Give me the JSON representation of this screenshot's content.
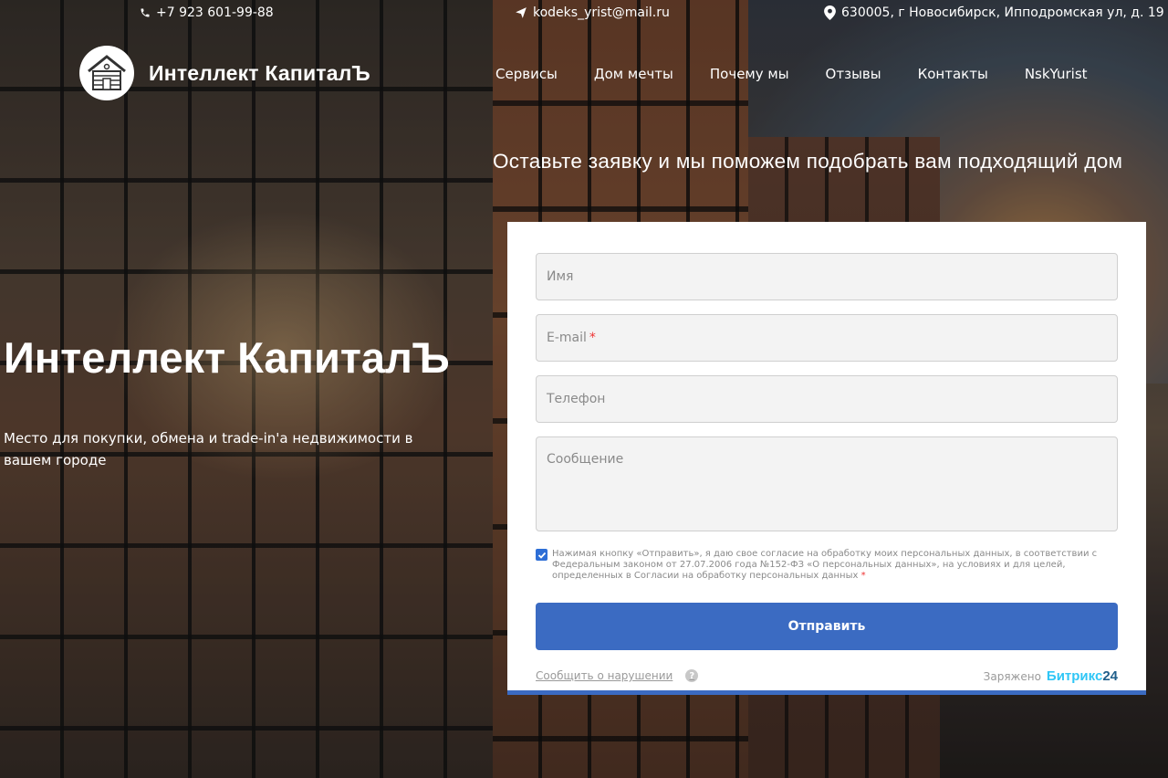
{
  "topbar": {
    "phone": "+7 923 601-99-88",
    "email": "kodeks_yrist@mail.ru",
    "address": "630005, г Новосибирск, Ипподромская ул, д. 19"
  },
  "brand": {
    "name": "Интеллект КапиталЪ"
  },
  "nav": {
    "items": [
      "Сервисы",
      "Дом мечты",
      "Почему мы",
      "Отзывы",
      "Контакты",
      "NskYurist"
    ]
  },
  "hero": {
    "title": "Интеллект КапиталЪ",
    "subtitle": "Место для покупки, обмена и trade-in'a недвижимости в вашем городе"
  },
  "cta": "Оставьте заявку и мы поможем подобрать вам подходящий дом",
  "form": {
    "name_placeholder": "Имя",
    "email_placeholder": "E-mail",
    "email_required": "*",
    "phone_placeholder": "Телефон",
    "message_placeholder": "Сообщение",
    "consent_text": "Нажимая кнопку «Отправить», я даю свое согласие на обработку моих персональных данных, в соответствии с Федеральным законом от 27.07.2006 года №152-ФЗ «О персональных данных», на условиях и для целей, определенных в Согласии на обработку персональных данных",
    "consent_required": "*",
    "consent_checked": true,
    "submit_label": "Отправить",
    "report_link": "Сообщить о нарушении",
    "report_help": "?",
    "powered_label": "Заряжено",
    "powered_brand": "Битрикс",
    "powered_num": "24"
  },
  "colors": {
    "accent": "#3b6bc2",
    "bitrix": "#2fc6f6"
  },
  "icons": {
    "phone": "phone-icon",
    "email": "paper-plane-icon",
    "address": "map-pin-icon",
    "logo": "log-house-icon"
  }
}
